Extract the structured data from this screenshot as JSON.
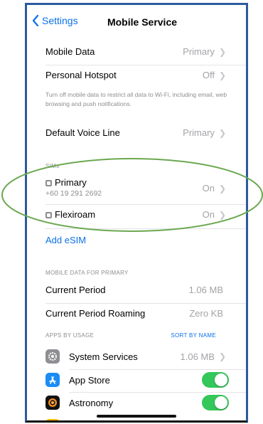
{
  "nav": {
    "back_label": "Settings",
    "title": "Mobile Service"
  },
  "rows": {
    "mobile_data": {
      "label": "Mobile Data",
      "value": "Primary"
    },
    "hotspot": {
      "label": "Personal Hotspot",
      "value": "Off"
    },
    "note": "Turn off mobile data to restrict all data to Wi-Fi, including email, web browsing and push notifications.",
    "voice": {
      "label": "Default Voice Line",
      "value": "Primary"
    }
  },
  "sims": {
    "header": "SIMs",
    "primary": {
      "label": "Primary",
      "number": "+60 19 291 2692",
      "value": "On"
    },
    "flexiroam": {
      "label": "Flexiroam",
      "value": "On"
    },
    "add_esim": "Add eSIM"
  },
  "usage": {
    "header": "MOBILE DATA FOR PRIMARY",
    "current_period": {
      "label": "Current Period",
      "value": "1.06 MB"
    },
    "roaming": {
      "label": "Current Period Roaming",
      "value": "Zero KB"
    },
    "apps_header": "APPS BY USAGE",
    "sort_label": "SORT BY NAME",
    "apps": [
      {
        "name": "System Services",
        "value": "1.06 MB",
        "icon": "gear-icon"
      },
      {
        "name": "App Store",
        "icon": "app-store-icon",
        "enabled": true
      },
      {
        "name": "Astronomy",
        "icon": "astronomy-icon",
        "enabled": true
      }
    ]
  },
  "colors": {
    "accent": "#0a70e8",
    "toggle_on": "#34c759",
    "annotation": "#6aa84f",
    "frame": "#2d5a9e"
  }
}
